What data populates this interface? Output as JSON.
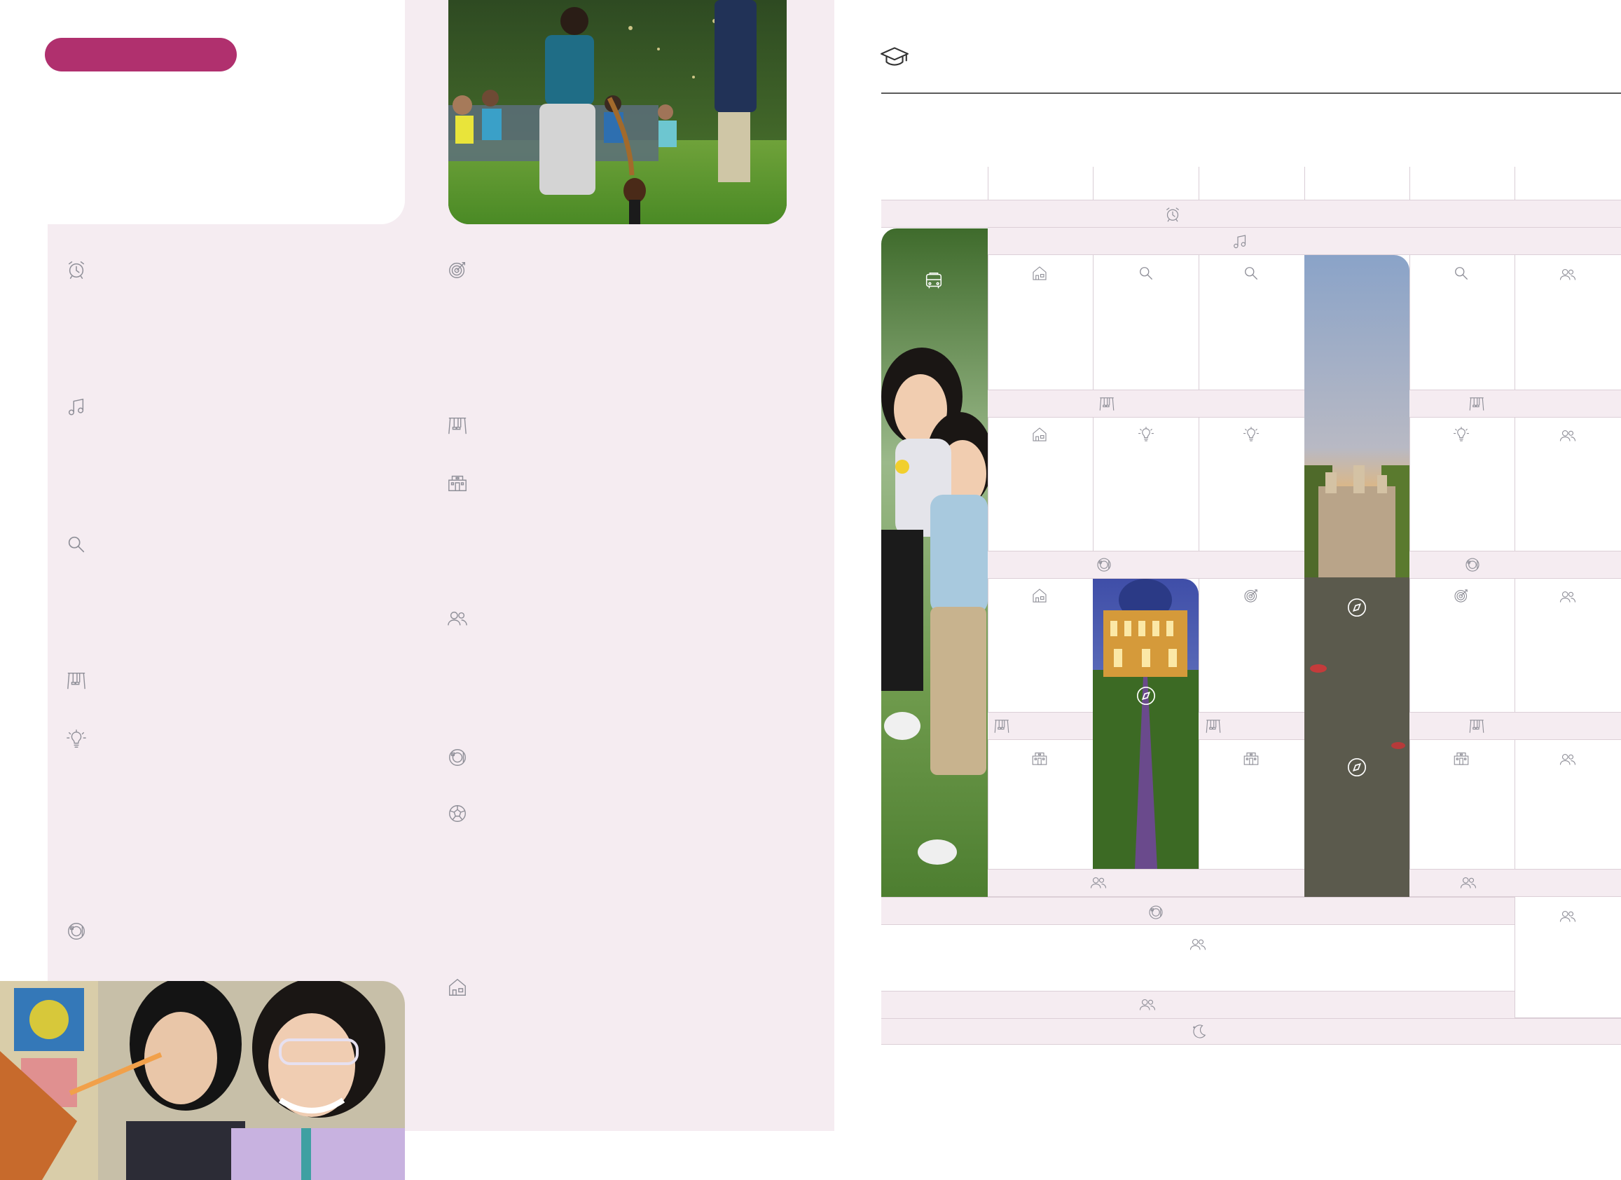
{
  "colors": {
    "accent": "#b0306e",
    "panel": "#f5ecf1",
    "icon": "#8f8f98",
    "rule": "#5b5b5b"
  },
  "left_page": {
    "header_pill": "",
    "left_icons": [
      "alarm-clock-icon",
      "music-note-icon",
      "search-icon",
      "swing-icon",
      "lightbulb-icon",
      "dining-icon"
    ],
    "right_icons": [
      "target-icon",
      "swing-icon",
      "building-icon",
      "people-icon",
      "dining-icon",
      "soccer-ball-icon",
      "house-icon"
    ]
  },
  "right_page": {
    "header_icon": "graduation-cap-icon",
    "timetable": {
      "columns": 7,
      "band_icons": [
        "alarm-clock-icon",
        "music-note-icon",
        "swing-icon",
        "dining-icon",
        "people-icon",
        "dining-icon",
        "people-icon",
        "people-icon",
        "moon-icon"
      ],
      "cell_icons": [
        "house-icon",
        "search-icon",
        "target-icon",
        "lightbulb-icon",
        "people-icon",
        "compass-icon",
        "building-icon",
        "bus-icon"
      ]
    }
  }
}
